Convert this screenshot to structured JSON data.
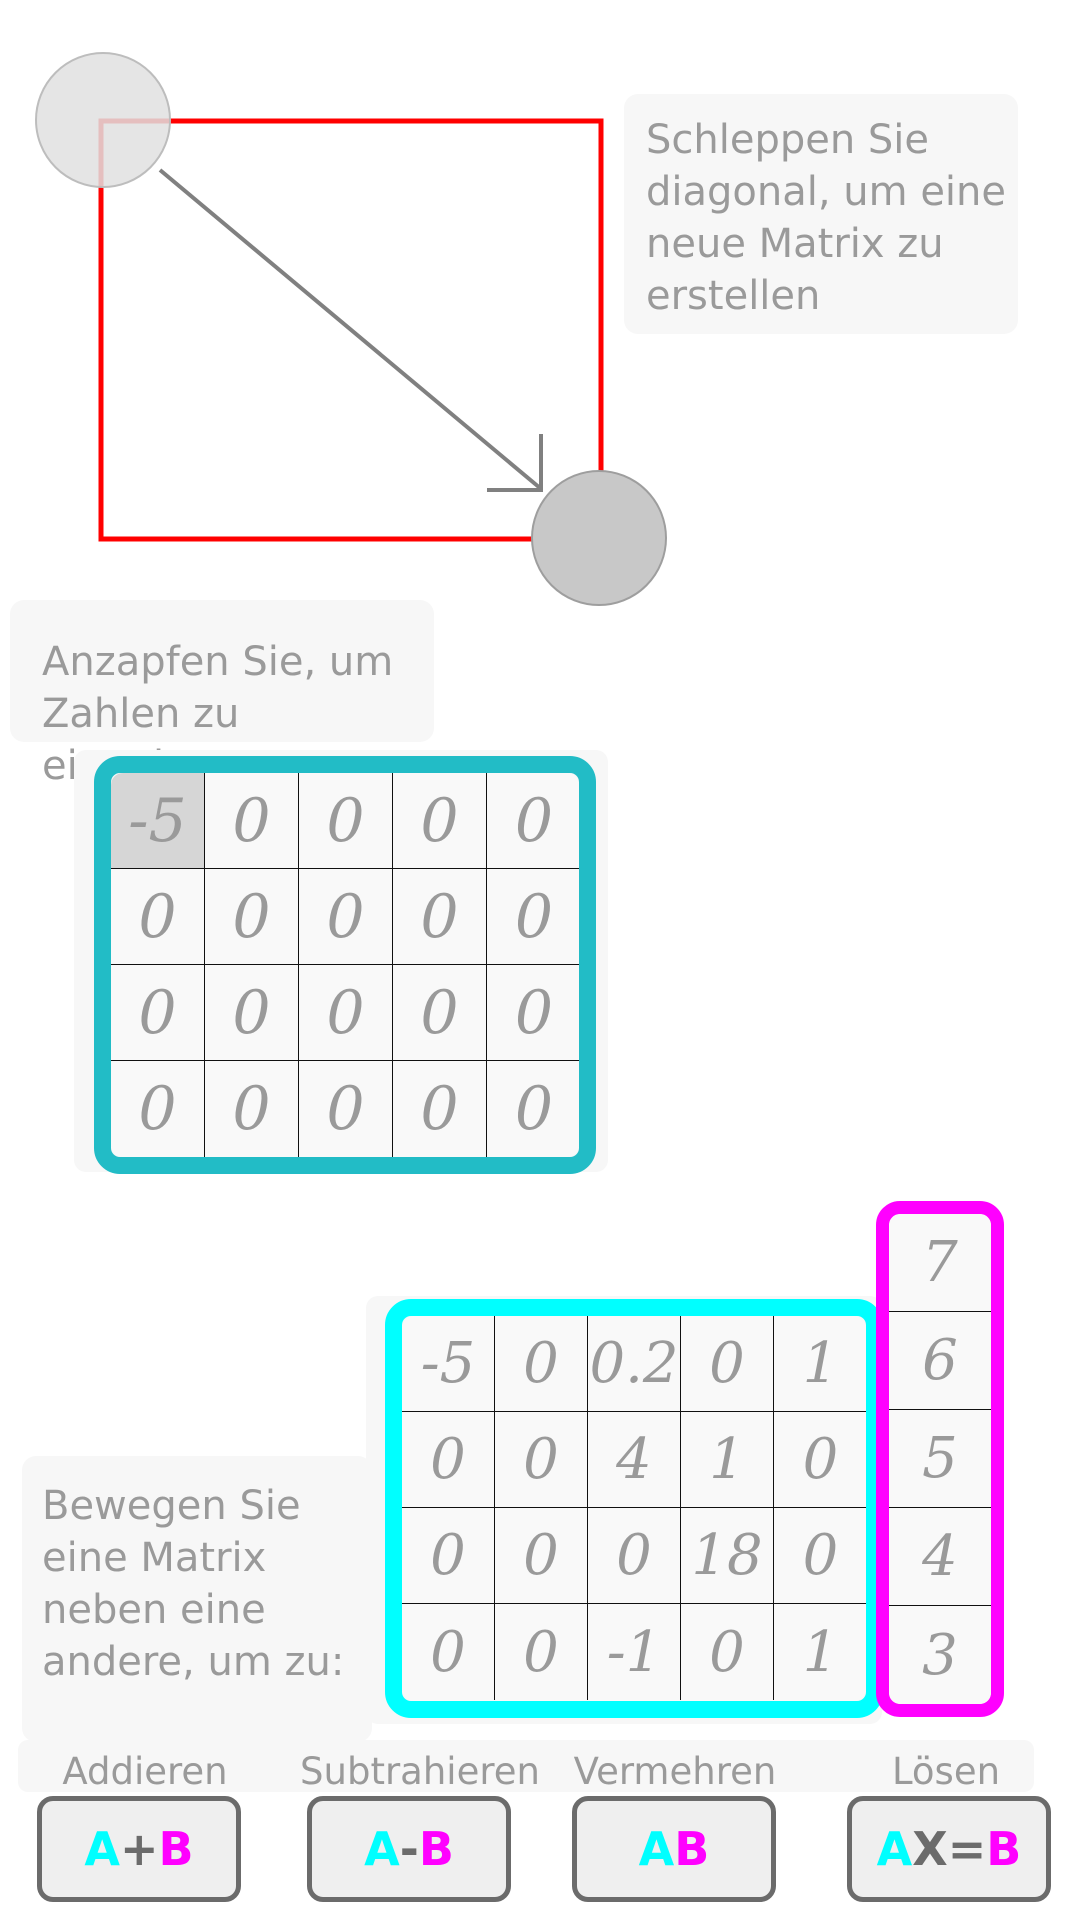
{
  "hints": {
    "drag": "Schleppen Sie diagonal, um eine neue Matrix zu erstellen",
    "tap": "Anzapfen Sie, um Zahlen zu eingeben",
    "move": "Bewegen Sie eine Matrix neben eine andere, um zu:"
  },
  "colors": {
    "teal": "#22bcc6",
    "cyan": "#00ffff",
    "magenta": "#ff00ff",
    "red": "#ff0000",
    "gray_text": "#9a9a9a"
  },
  "editor_matrix": {
    "rows": [
      [
        "-5",
        "0",
        "0",
        "0",
        "0"
      ],
      [
        "0",
        "0",
        "0",
        "0",
        "0"
      ],
      [
        "0",
        "0",
        "0",
        "0",
        "0"
      ],
      [
        "0",
        "0",
        "0",
        "0",
        "0"
      ]
    ],
    "active_cell": [
      0,
      0
    ]
  },
  "matrix_a": {
    "rows": [
      [
        "-5",
        "0",
        "0.2",
        "0",
        "1"
      ],
      [
        "0",
        "0",
        "4",
        "1",
        "0"
      ],
      [
        "0",
        "0",
        "0",
        "18",
        "0"
      ],
      [
        "0",
        "0",
        "-1",
        "0",
        "1"
      ]
    ]
  },
  "matrix_b": {
    "rows": [
      [
        "7"
      ],
      [
        "6"
      ],
      [
        "5"
      ],
      [
        "4"
      ],
      [
        "3"
      ]
    ]
  },
  "operations": [
    {
      "label": "Addieren",
      "parts": [
        {
          "t": "A",
          "c": "cyan"
        },
        {
          "t": "+",
          "c": "gray"
        },
        {
          "t": "B",
          "c": "magenta"
        }
      ]
    },
    {
      "label": "Subtrahieren",
      "parts": [
        {
          "t": "A",
          "c": "cyan"
        },
        {
          "t": "-",
          "c": "gray"
        },
        {
          "t": "B",
          "c": "magenta"
        }
      ]
    },
    {
      "label": "Vermehren",
      "parts": [
        {
          "t": "A",
          "c": "cyan"
        },
        {
          "t": "B",
          "c": "magenta"
        }
      ]
    },
    {
      "label": "Lösen",
      "parts": [
        {
          "t": "A",
          "c": "cyan"
        },
        {
          "t": "X=",
          "c": "gray"
        },
        {
          "t": "B",
          "c": "magenta"
        }
      ]
    }
  ]
}
